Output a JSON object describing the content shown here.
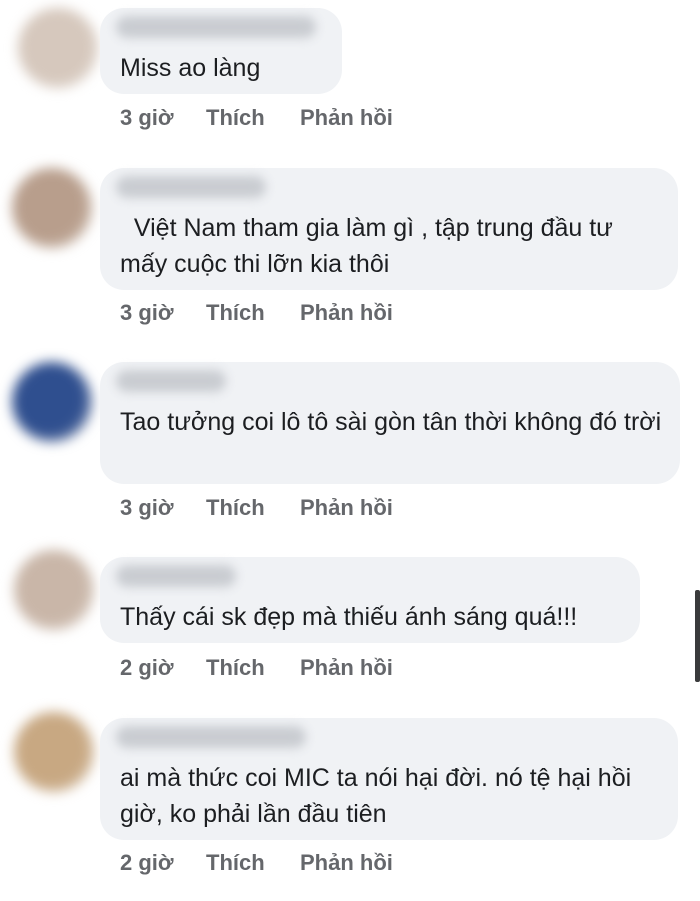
{
  "comments": [
    {
      "text": "Miss ao làng",
      "time": "3 giờ",
      "like_label": "Thích",
      "reply_label": "Phản hồi",
      "avatar_color": "#d6c8bd"
    },
    {
      "text": "  Việt Nam tham gia làm gì , tập trung đầu tư mấy cuộc thi lỡn kia thôi",
      "time": "3 giờ",
      "like_label": "Thích",
      "reply_label": "Phản hồi",
      "avatar_color": "#b89e8c"
    },
    {
      "text": "Tao tưởng coi lô tô sài gòn tân thời không đó trời",
      "time": "3 giờ",
      "like_label": "Thích",
      "reply_label": "Phản hồi",
      "avatar_color": "#2f4f8f"
    },
    {
      "text": "Thấy cái sk đẹp mà thiếu ánh sáng quá!!!",
      "time": "2 giờ",
      "like_label": "Thích",
      "reply_label": "Phản hồi",
      "avatar_color": "#c9b6a8"
    },
    {
      "text": "ai mà thức coi MIC ta nói hại đời. nó tệ hại hồi giờ, ko phải lần đầu tiên",
      "time": "2 giờ",
      "like_label": "Thích",
      "reply_label": "Phản hồi",
      "avatar_color": "#c8a882"
    }
  ]
}
